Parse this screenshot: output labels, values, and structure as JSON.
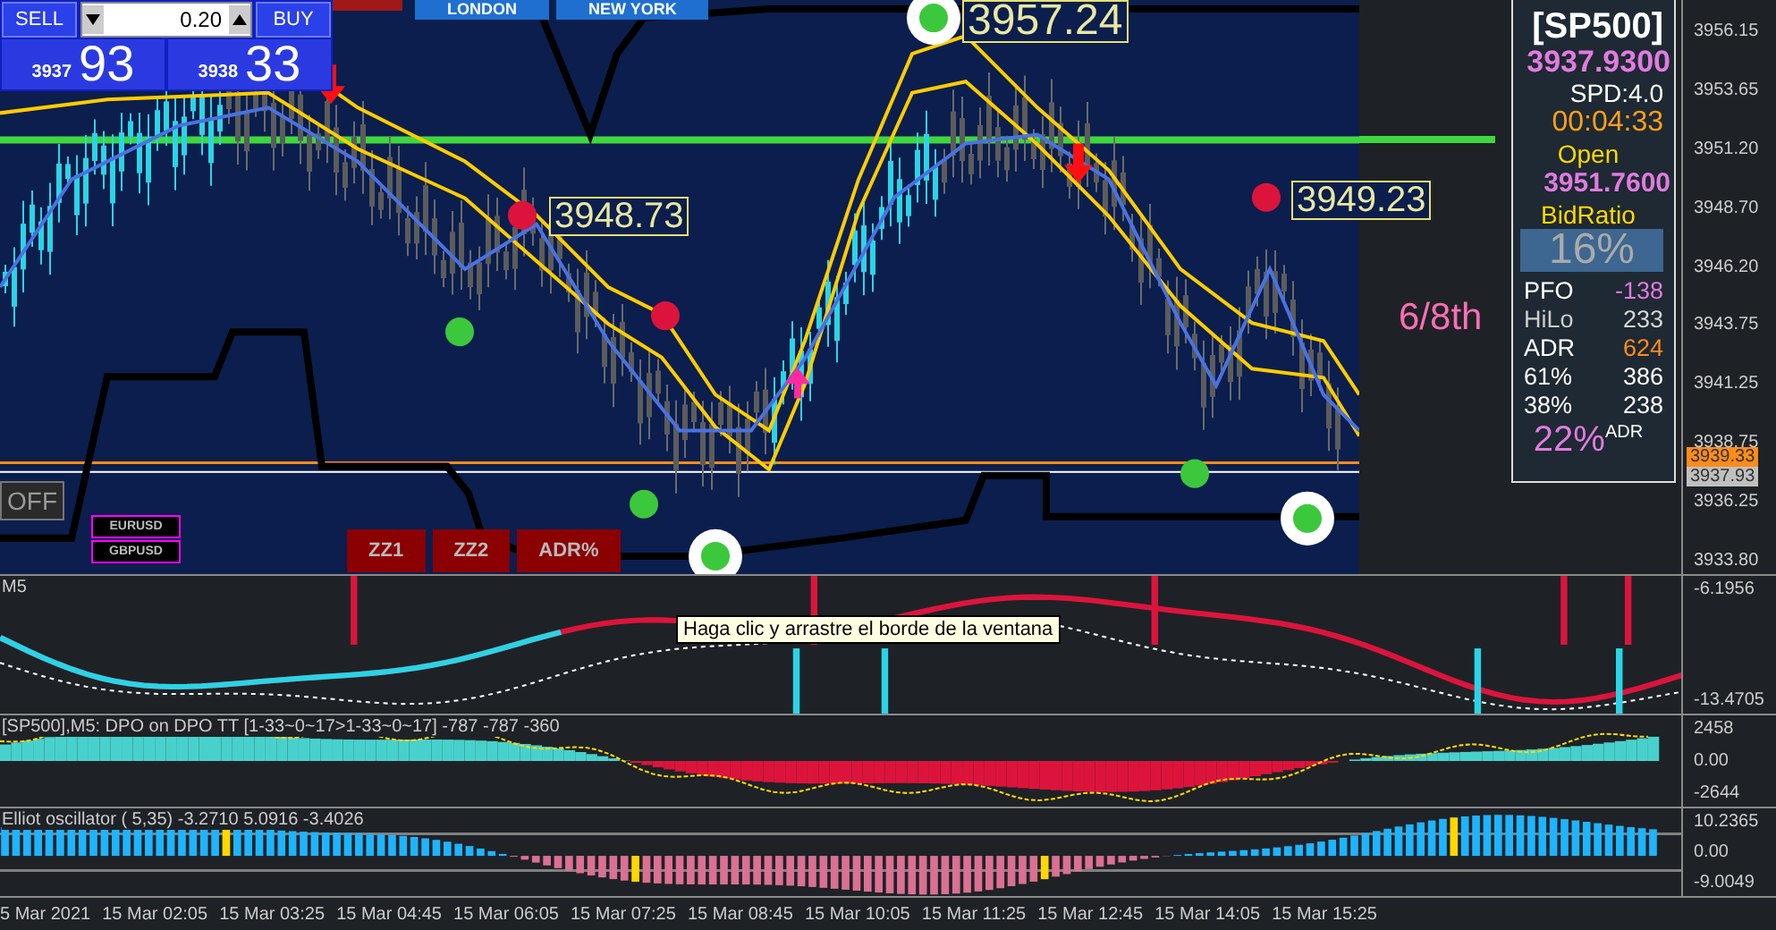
{
  "trade_panel": {
    "sell_label": "SELL",
    "buy_label": "BUY",
    "lot": "0.20",
    "bid_figure": "3937",
    "bid_pips": "93",
    "ask_figure": "3938",
    "ask_pips": "33"
  },
  "sessions": [
    "LONDON",
    "NEW YORK"
  ],
  "chart": {
    "price_labels": [
      "3957.24",
      "3948.73",
      "3949.23"
    ],
    "off_button": "OFF",
    "symbol_buttons": [
      "EURUSD",
      "GBPUSD"
    ],
    "tool_buttons": [
      "ZZ1",
      "ZZ2",
      "ADR%"
    ],
    "octave_label": "6/8th"
  },
  "info_panel": {
    "symbol": "[SP500]",
    "bid": "3937.9300",
    "spread": "SPD:4.0",
    "countdown": "00:04:33",
    "open_label": "Open",
    "open_price": "3951.7600",
    "ratio_label": "BidRatio",
    "ratio": "16%",
    "stats": [
      {
        "label": "PFO",
        "value": "-138",
        "color": "#e07be0"
      },
      {
        "label": "HiLo",
        "value": "233",
        "color": "#d8d8d8"
      },
      {
        "label": "ADR",
        "value": "624",
        "color": "#ff8c1a"
      },
      {
        "label": "61%",
        "value": "386",
        "color": "#ffffff"
      },
      {
        "label": "38%",
        "value": "238",
        "color": "#ffffff"
      }
    ],
    "adr_share": "22%$^{ADR}$"
  },
  "price_axis": {
    "ticks": [
      "3956.15",
      "3953.65",
      "3951.20",
      "3948.70",
      "3946.20",
      "3943.75",
      "3941.25",
      "3938.75",
      "3936.25",
      "3933.80"
    ],
    "current_labels": [
      {
        "text": "3939.33",
        "kind": "ask"
      },
      {
        "text": "3937.93",
        "kind": "bid"
      }
    ]
  },
  "panes": [
    {
      "kind": "trend",
      "title": "M5",
      "tooltip": "Haga clic y arrastre el borde de la ventana",
      "ticks": [
        "-6.1956",
        "-13.4705"
      ]
    },
    {
      "kind": "dpo",
      "title": "[SP500],M5: DPO on DPO TT [1-33~0~17>1-33~0~17]  -787 -787 -360",
      "ticks": [
        "2458",
        "0.00",
        "-2644"
      ]
    },
    {
      "kind": "elliot",
      "title": "Elliot oscillator ( 5,35) -3.2710 5.0916 -3.4026",
      "ticks": [
        "10.2365",
        "0.00",
        "-9.0049"
      ]
    }
  ],
  "time_axis": [
    "5 Mar 2021",
    "15 Mar 02:05",
    "15 Mar 03:25",
    "15 Mar 04:45",
    "15 Mar 06:05",
    "15 Mar 07:25",
    "15 Mar 08:45",
    "15 Mar 10:05",
    "15 Mar 11:25",
    "15 Mar 12:45",
    "15 Mar 14:05",
    "15 Mar 15:25"
  ]
}
